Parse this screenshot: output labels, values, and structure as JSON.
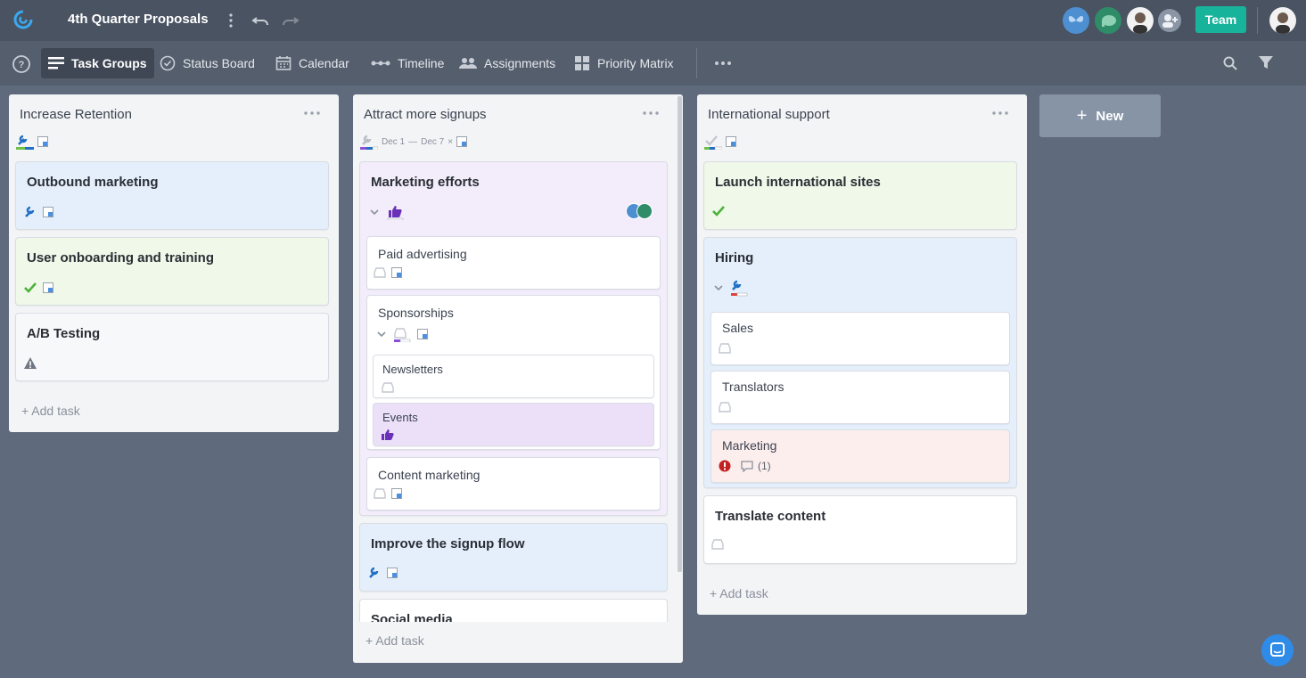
{
  "header": {
    "title": "4th Quarter Proposals",
    "team_label": "Team"
  },
  "nav": {
    "items": [
      {
        "label": "Task Groups"
      },
      {
        "label": "Status Board"
      },
      {
        "label": "Calendar"
      },
      {
        "label": "Timeline"
      },
      {
        "label": "Assignments"
      },
      {
        "label": "Priority Matrix"
      }
    ]
  },
  "columns": [
    {
      "title": "Increase Retention",
      "add_task": "+ Add task",
      "cards": [
        {
          "title": "Outbound marketing"
        },
        {
          "title": "User onboarding and training"
        },
        {
          "title": "A/B Testing"
        }
      ]
    },
    {
      "title": "Attract more signups",
      "date_start": "Dec 1",
      "date_end": "Dec 7",
      "add_task": "+ Add task",
      "cards": [
        {
          "title": "Marketing efforts",
          "subtasks": [
            {
              "title": "Paid advertising"
            },
            {
              "title": "Sponsorships",
              "subtasks": [
                {
                  "title": "Newsletters"
                },
                {
                  "title": "Events"
                }
              ]
            },
            {
              "title": "Content marketing"
            }
          ]
        },
        {
          "title": "Improve the signup flow"
        },
        {
          "title": "Social media"
        }
      ]
    },
    {
      "title": "International support",
      "add_task": "+ Add task",
      "cards": [
        {
          "title": "Launch international sites"
        },
        {
          "title": "Hiring",
          "subtasks": [
            {
              "title": "Sales"
            },
            {
              "title": "Translators"
            },
            {
              "title": "Marketing",
              "comments": "(1)"
            }
          ]
        },
        {
          "title": "Translate content"
        }
      ]
    }
  ],
  "new_button": "New",
  "colors": {
    "accent": "#18b39b",
    "chat": "#2f8be8",
    "background": "#5f6b7c"
  }
}
